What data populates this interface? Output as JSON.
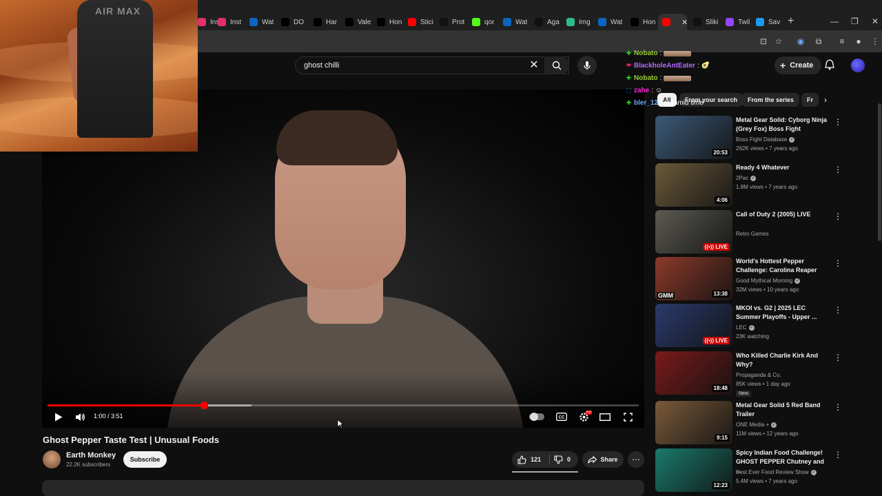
{
  "browser": {
    "tabs": [
      {
        "label": "Inst",
        "icon": "instagram-icon",
        "color": "#e1306c"
      },
      {
        "label": "Inst",
        "icon": "instagram-icon",
        "color": "#e1306c"
      },
      {
        "label": "Wat",
        "icon": "infinity-icon",
        "color": "#0a66c2"
      },
      {
        "label": "DO",
        "icon": "x-icon",
        "color": "#000000"
      },
      {
        "label": "Har",
        "icon": "x-icon",
        "color": "#000000"
      },
      {
        "label": "Vale",
        "icon": "x-icon",
        "color": "#000000"
      },
      {
        "label": "Hon",
        "icon": "x-icon",
        "color": "#000000"
      },
      {
        "label": "Stici",
        "icon": "youtube-icon",
        "color": "#ff0000"
      },
      {
        "label": "Prot",
        "icon": "tiktok-icon",
        "color": "#111111"
      },
      {
        "label": "qor",
        "icon": "kick-icon",
        "color": "#53fc18"
      },
      {
        "label": "Wat",
        "icon": "infinity-icon",
        "color": "#0a66c2"
      },
      {
        "label": "Aga",
        "icon": "tiktok-icon",
        "color": "#111111"
      },
      {
        "label": "Img",
        "icon": "image-icon",
        "color": "#2bbc8a"
      },
      {
        "label": "Wat",
        "icon": "infinity-icon",
        "color": "#0a66c2"
      },
      {
        "label": "Hon",
        "icon": "x-icon",
        "color": "#000000"
      },
      {
        "label": "",
        "icon": "youtube-icon",
        "color": "#ff0000",
        "active": true
      },
      {
        "label": "Sliki",
        "icon": "tiktok-icon",
        "color": "#111111"
      },
      {
        "label": "Twil",
        "icon": "twitch-icon",
        "color": "#9146ff"
      },
      {
        "label": "Sav",
        "icon": "check-icon",
        "color": "#1d9bf0"
      }
    ]
  },
  "search": {
    "query": "ghost chilli"
  },
  "header": {
    "create_label": "Create"
  },
  "webcam": {
    "shirt_text": "AIR MAX"
  },
  "player": {
    "time": "1:00 / 3:51",
    "progress_fraction": 0.265,
    "buffer_fraction": 0.345
  },
  "video": {
    "title": "Ghost Pepper Taste Test | Unusual Foods",
    "channel": "Earth Monkey",
    "subscribers": "22.2K subscribers",
    "subscribe_label": "Subscribe",
    "likes": "121",
    "dislikes": "0",
    "share_label": "Share"
  },
  "chat": [
    {
      "badge": "✚",
      "badge_color": "#35d035",
      "user": "Nobato",
      "user_color": "#9acd32",
      "emote": true,
      "message": ""
    },
    {
      "badge": "❤",
      "badge_color": "#e91e63",
      "user": "BlackholeAntEater",
      "user_color": "#b16bff",
      "emote": false,
      "message": "🥑"
    },
    {
      "badge": "✚",
      "badge_color": "#35d035",
      "user": "Nobato",
      "user_color": "#9acd32",
      "emote": true,
      "message": ""
    },
    {
      "badge": "⬚",
      "badge_color": "#2196f3",
      "user": "zahe",
      "user_color": "#ff2bd6",
      "emote": false,
      "message": "☺"
    },
    {
      "badge": "✚",
      "badge_color": "#35d035",
      "user": "bler_12",
      "user_color": "#6fa8ff",
      "emote": false,
      "message": "pyramid time"
    }
  ],
  "chips": [
    "All",
    "From your search",
    "From the series",
    "Fr"
  ],
  "recommendations": [
    {
      "title": "Metal Gear Solid: Cyborg Ninja (Grey Fox) Boss Fight",
      "channel": "Boss Fight Database",
      "verified": true,
      "meta": "262K views • 7 years ago",
      "duration": "20:53",
      "live": false,
      "thumb_color": "#3c5a78",
      "new": false
    },
    {
      "title": "Ready 4 Whatever",
      "channel": "2Pac",
      "verified": true,
      "meta": "1.8M views • 7 years ago",
      "duration": "4:06",
      "live": false,
      "thumb_color": "#6b5a3a",
      "new": false
    },
    {
      "title": "Call of Duty 2 (2005) LIVE",
      "channel": "Retro Games",
      "verified": false,
      "meta": "",
      "duration": "LIVE",
      "live": true,
      "thumb_color": "#5c5a52",
      "new": false
    },
    {
      "title": "World's Hottest Pepper Challenge: Carolina Reaper",
      "channel": "Good Mythical Morning",
      "verified": true,
      "meta": "32M views • 10 years ago",
      "duration": "13:38",
      "live": false,
      "thumb_color": "#8c3a2a",
      "new": false
    },
    {
      "title": "MKOI vs. G2 | 2025 LEC Summer Playoffs - Upper ...",
      "channel": "LEC",
      "verified": true,
      "meta": "23K watching",
      "duration": "LIVE",
      "live": true,
      "thumb_color": "#2a3a6b",
      "new": false
    },
    {
      "title": "Who Killed Charlie Kirk And Why?",
      "channel": "Propaganda & Co.",
      "verified": false,
      "meta": "85K views • 1 day ago",
      "duration": "18:48",
      "live": false,
      "thumb_color": "#7a1a1a",
      "new": true
    },
    {
      "title": "Metal Gear Solid 5 Red Band Trailer",
      "channel": "ONE Media +",
      "verified": true,
      "meta": "11M views • 12 years ago",
      "duration": "9:15",
      "live": false,
      "thumb_color": "#7a5a3a",
      "new": false
    },
    {
      "title": "Spicy Indian Food Challenge! GHOST PEPPER Chutney and ...",
      "channel": "Best Ever Food Review Show",
      "verified": true,
      "meta": "5.4M views • 7 years ago",
      "duration": "12:23",
      "live": false,
      "thumb_color": "#1a7a6b",
      "new": false
    }
  ],
  "labels": {
    "new": "New",
    "gmm": "GMM"
  }
}
